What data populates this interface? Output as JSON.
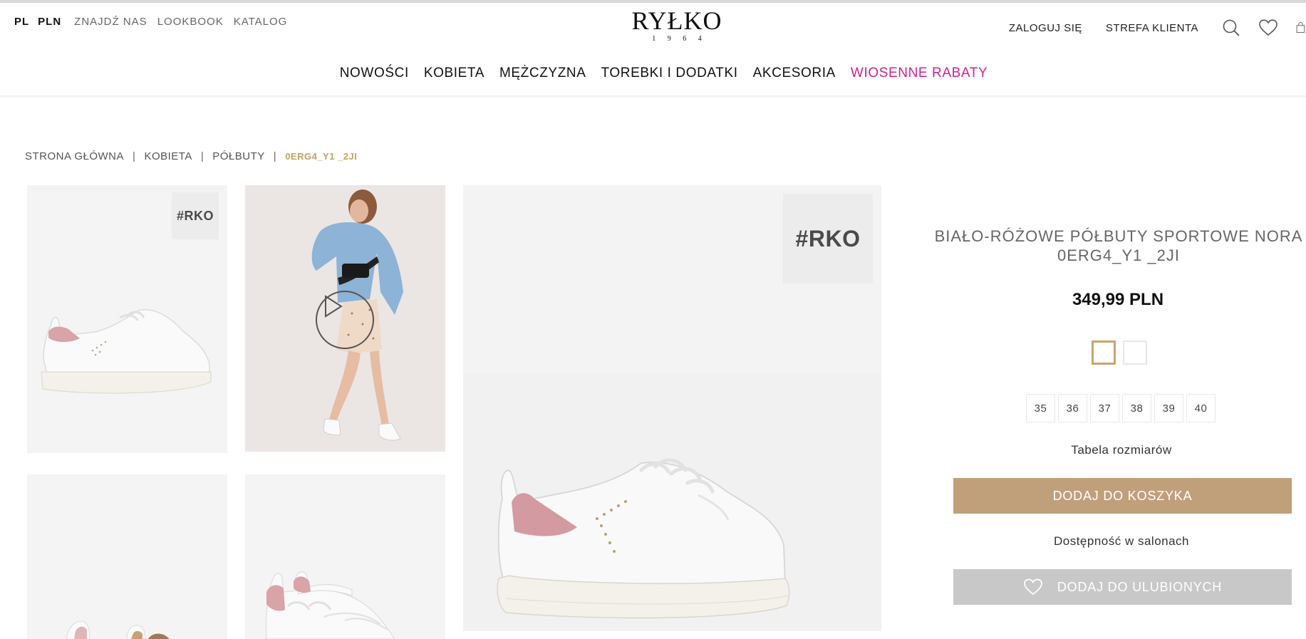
{
  "header": {
    "language": "PL",
    "currency": "PLN",
    "links": [
      "ZNAJDŹ NAS",
      "LOOKBOOK",
      "KATALOG"
    ],
    "logo": {
      "name": "RYŁKO",
      "year": "1 9 6 4"
    },
    "login": "ZALOGUJ SIĘ",
    "client_zone": "STREFA KLIENTA",
    "icons": [
      "search-icon",
      "heart-icon",
      "bag-icon"
    ]
  },
  "nav": {
    "items": [
      "NOWOŚCI",
      "KOBIETA",
      "MĘŻCZYZNA",
      "TOREBKI I DODATKI",
      "AKCESORIA"
    ],
    "sale": "WIOSENNE RABATY",
    "sale_color": "#d21e8c"
  },
  "breadcrumb": {
    "items": [
      "STRONA GŁÓWNA",
      "KOBIETA",
      "PÓŁBUTY"
    ],
    "separator": "|",
    "current": "0ERG4_Y1 _2JI",
    "current_color": "#c2a163"
  },
  "gallery": {
    "badge": "#RKO",
    "thumbnails": [
      "shoe-side-view",
      "model-video",
      "shoe-heel-view",
      "shoe-pair-view"
    ]
  },
  "product": {
    "title_line1": "BIAŁO-RÓŻOWE PÓŁBUTY SPORTOWE NORA",
    "title_line2": "0ERG4_Y1 _2JI",
    "price": "349,99 PLN",
    "swatch_active_color": "#c9a56c",
    "sizes": [
      "35",
      "36",
      "37",
      "38",
      "39",
      "40"
    ],
    "size_table": "Tabela rozmiarów",
    "add_to_cart": "DODAJ DO KOSZYKA",
    "cart_color": "#c0a07a",
    "availability": "Dostępność w salonach",
    "add_to_favorites": "DODAJ DO ULUBIONYCH"
  }
}
